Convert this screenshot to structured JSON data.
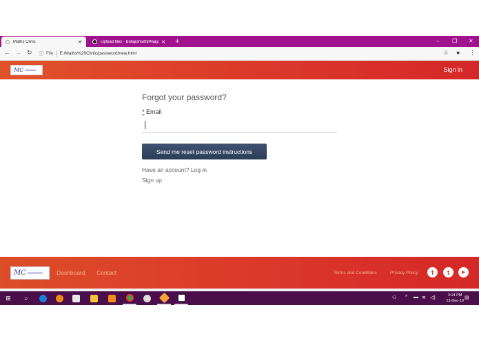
{
  "browser": {
    "tabs": [
      {
        "label": "Maths Clinic",
        "active": true
      },
      {
        "label": "Upload files · Bolajiomo99/Naija",
        "active": false
      }
    ],
    "url_scheme_label": "File",
    "url": "E:/Maths%20Clinic/password/new.html",
    "icons": {
      "back": "arrow-left-icon",
      "forward": "arrow-right-icon",
      "reload": "reload-icon",
      "info": "info-icon",
      "star": "star-icon",
      "account": "account-icon",
      "menu": "kebab-menu-icon"
    }
  },
  "header": {
    "logo_text": "MC",
    "signin_label": "Sign in"
  },
  "form": {
    "title": "Forgot your password?",
    "required_mark": "*",
    "email_label": " Email",
    "email_value": "",
    "submit_label": "Send me reset password instructions",
    "login_link": "Have an account? Log in",
    "signup_link": "Sign up"
  },
  "footer": {
    "logo_text": "MC",
    "dashboard_label": "Dashboard",
    "contact_label": "Contact",
    "terms_label": "Terms and Conditions",
    "privacy_label": "Privacy Policy",
    "social": [
      {
        "name": "facebook-icon",
        "glyph": "f"
      },
      {
        "name": "twitter-icon",
        "glyph": "t"
      },
      {
        "name": "youtube-icon",
        "glyph": "▶"
      }
    ]
  },
  "taskbar": {
    "time": "3:14 PM",
    "date": "13-Dec-19"
  },
  "colors": {
    "tabstrip": "#a0128e",
    "header_gradient_start": "#e0522a",
    "header_gradient_end": "#d42828",
    "button": "#34485f",
    "taskbar": "#4a0e4a"
  }
}
